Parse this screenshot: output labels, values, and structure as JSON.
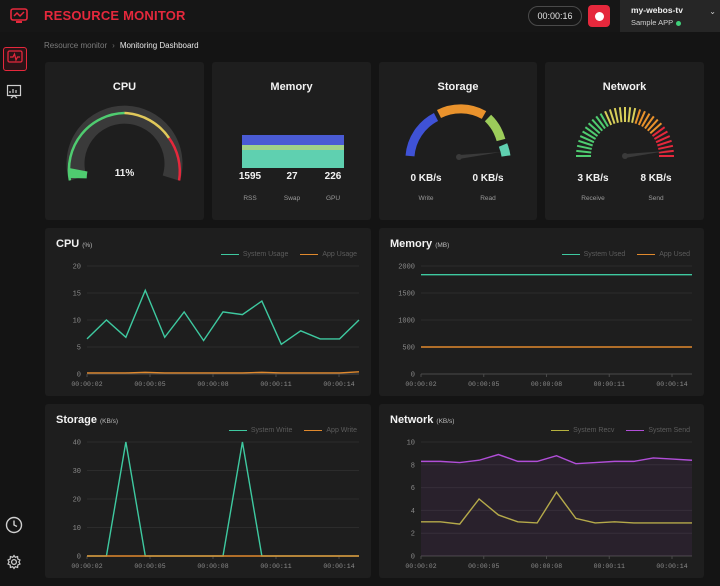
{
  "header": {
    "app_title": "RESOURCE MONITOR",
    "timer": "00:00:16",
    "device_name": "my-webos-tv",
    "device_app": "Sample APP"
  },
  "colors": {
    "accent": "#e5283c",
    "teal": "#3ec9a0",
    "orange": "#e0892d",
    "purple": "#b14ed8",
    "olive": "#b6b23e"
  },
  "icons": [
    "logo-icon",
    "monitor-icon",
    "chart-icon",
    "clock-icon",
    "gear-icon",
    "record-icon",
    "chevron-down-icon"
  ],
  "breadcrumb": {
    "root": "Resource monitor",
    "separator": "›",
    "current": "Monitoring Dashboard"
  },
  "cards": {
    "cpu": {
      "title": "CPU",
      "value": "11%",
      "percent": 11
    },
    "memory": {
      "title": "Memory",
      "stats": [
        {
          "value": "1595",
          "label": "RSS"
        },
        {
          "value": "27",
          "label": "Swap"
        },
        {
          "value": "226",
          "label": "GPU"
        }
      ]
    },
    "storage": {
      "title": "Storage",
      "stats": [
        {
          "value": "0 KB/s",
          "label": "Write"
        },
        {
          "value": "0 KB/s",
          "label": "Read"
        }
      ]
    },
    "network": {
      "title": "Network",
      "stats": [
        {
          "value": "3 KB/s",
          "label": "Receive"
        },
        {
          "value": "8 KB/s",
          "label": "Send"
        }
      ]
    }
  },
  "chart_data": [
    {
      "id": "cpu",
      "type": "line",
      "title": "CPU",
      "unit": "(%)",
      "x": [
        "00:00:02",
        "00:00:05",
        "00:00:08",
        "00:00:11",
        "00:00:14"
      ],
      "ylim": [
        0,
        20
      ],
      "yticks": [
        0,
        5,
        10,
        15,
        20
      ],
      "series": [
        {
          "name": "System Usage",
          "color": "#3ec9a0",
          "values": [
            6.5,
            10,
            6.8,
            15.5,
            6.8,
            11.5,
            6.2,
            11.5,
            11,
            13.5,
            5.5,
            8,
            6.5,
            6.5,
            10
          ]
        },
        {
          "name": "App Usage",
          "color": "#e0892d",
          "values": [
            0.2,
            0.2,
            0.2,
            0.3,
            0.2,
            0.2,
            0.2,
            0.2,
            0.2,
            0.3,
            0.2,
            0.2,
            0.2,
            0.2,
            0.4
          ]
        }
      ]
    },
    {
      "id": "memory",
      "type": "line",
      "title": "Memory",
      "unit": "(MB)",
      "x": [
        "00:00:02",
        "00:00:05",
        "00:00:08",
        "00:00:11",
        "00:00:14"
      ],
      "ylim": [
        0,
        2000
      ],
      "yticks": [
        0,
        500,
        1000,
        1500,
        2000
      ],
      "series": [
        {
          "name": "System Used",
          "color": "#3ec9a0",
          "values": [
            1840,
            1840,
            1840,
            1840,
            1840,
            1840,
            1840,
            1840,
            1840,
            1840,
            1840,
            1840,
            1840,
            1840,
            1840
          ]
        },
        {
          "name": "App Used",
          "color": "#e0892d",
          "values": [
            500,
            500,
            500,
            500,
            500,
            500,
            500,
            500,
            500,
            500,
            500,
            500,
            500,
            500,
            500
          ]
        }
      ]
    },
    {
      "id": "storage",
      "type": "line",
      "title": "Storage",
      "unit": "(KB/s)",
      "x": [
        "00:00:02",
        "00:00:05",
        "00:00:08",
        "00:00:11",
        "00:00:14"
      ],
      "ylim": [
        0,
        40
      ],
      "yticks": [
        0,
        10,
        20,
        30,
        40
      ],
      "series": [
        {
          "name": "System Write",
          "color": "#3ec9a0",
          "values": [
            0,
            0,
            40,
            0,
            0,
            0,
            0,
            0,
            40,
            0,
            0,
            0,
            0,
            0,
            0
          ]
        },
        {
          "name": "App Write",
          "color": "#e0892d",
          "values": [
            0,
            0,
            0,
            0,
            0,
            0,
            0,
            0,
            0,
            0,
            0,
            0,
            0,
            0,
            0
          ]
        }
      ]
    },
    {
      "id": "network",
      "type": "line",
      "title": "Network",
      "unit": "(KB/s)",
      "x": [
        "00:00:02",
        "00:00:05",
        "00:00:08",
        "00:00:11",
        "00:00:14"
      ],
      "ylim": [
        0,
        10
      ],
      "yticks": [
        0,
        2,
        4,
        6,
        8,
        10
      ],
      "series": [
        {
          "name": "System Recv",
          "color": "#b6b23e",
          "values": [
            3,
            3,
            2.8,
            5,
            3.6,
            3,
            2.9,
            5.6,
            3.3,
            2.9,
            3,
            2.9,
            2.9,
            2.9,
            2.9
          ]
        },
        {
          "name": "System Send",
          "color": "#b14ed8",
          "values": [
            8.3,
            8.3,
            8.2,
            8.4,
            8.9,
            8.3,
            8.3,
            8.8,
            8.1,
            8.2,
            8.3,
            8.3,
            8.6,
            8.5,
            8.4
          ]
        }
      ]
    }
  ]
}
